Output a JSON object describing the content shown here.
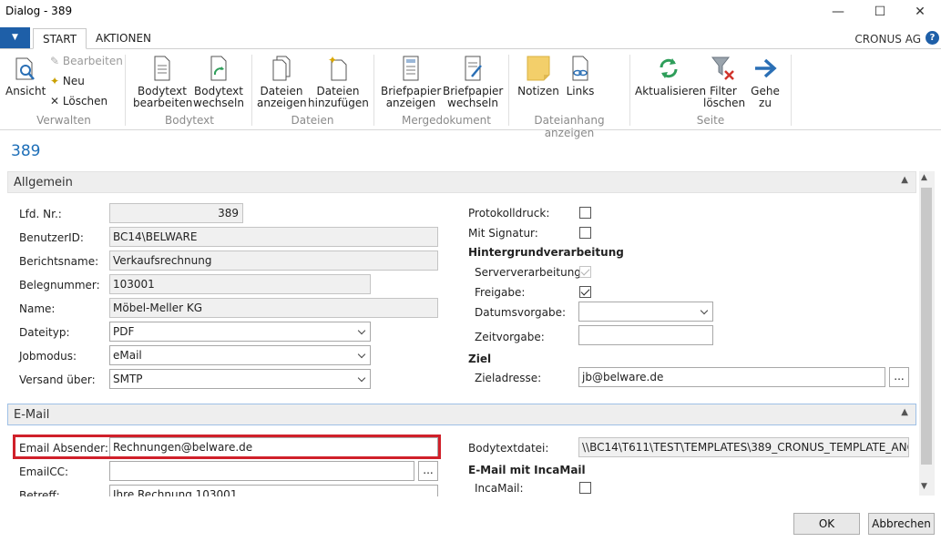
{
  "window": {
    "title": "Dialog - 389",
    "minimize": "—",
    "maximize": "☐",
    "close": "✕"
  },
  "ribbon_tabs": {
    "menu": "▼",
    "start": "START",
    "actions": "AKTIONEN"
  },
  "company": "CRONUS AG",
  "help": "?",
  "ribbon": {
    "ansicht": "Ansicht",
    "bearbeiten": "Bearbeiten",
    "neu": "Neu",
    "loeschen": "Löschen",
    "verwalten": "Verwalten",
    "bodytext_bearbeiten": [
      "Bodytext",
      "bearbeiten"
    ],
    "bodytext_wechseln": [
      "Bodytext",
      "wechseln"
    ],
    "bodytext_group": "Bodytext",
    "dateien_anzeigen": [
      "Dateien",
      "anzeigen"
    ],
    "dateien_hinzufuegen": [
      "Dateien",
      "hinzufügen"
    ],
    "dateien_group": "Dateien",
    "briefpapier_anzeigen": [
      "Briefpapier",
      "anzeigen"
    ],
    "briefpapier_wechseln": [
      "Briefpapier",
      "wechseln"
    ],
    "mergedokument_group": "Mergedokument",
    "notizen": "Notizen",
    "links": "Links",
    "dateianhang_group": "Dateianhang anzeigen",
    "aktualisieren": "Aktualisieren",
    "filter_loeschen": [
      "Filter",
      "löschen"
    ],
    "gehe_zu": [
      "Gehe",
      "zu"
    ],
    "seite_group": "Seite"
  },
  "page_title": "389",
  "allgemein": {
    "header": "Allgemein",
    "lfd_nr_label": "Lfd. Nr.:",
    "lfd_nr": "389",
    "benutzer_label": "BenutzerID:",
    "benutzer": "BC14\\BELWARE",
    "bericht_label": "Berichtsname:",
    "bericht": "Verkaufsrechnung",
    "beleg_label": "Belegnummer:",
    "beleg": "103001",
    "name_label": "Name:",
    "name": "Möbel-Meller KG",
    "dateityp_label": "Dateityp:",
    "dateityp": "PDF",
    "jobmodus_label": "Jobmodus:",
    "jobmodus": "eMail",
    "versand_label": "Versand über:",
    "versand": "SMTP",
    "protokoll_label": "Protokolldruck:",
    "protokoll": false,
    "signatur_label": "Mit Signatur:",
    "signatur": false,
    "hintergrund_label": "Hintergrundverarbeitung",
    "server_label": "Serververarbeitung:",
    "server": true,
    "freigabe_label": "Freigabe:",
    "freigabe": true,
    "datum_label": "Datumsvorgabe:",
    "datum": "",
    "zeit_label": "Zeitvorgabe:",
    "zeit": "",
    "ziel_label": "Ziel",
    "zieladresse_label": "Zieladresse:",
    "zieladresse": "jb@belware.de",
    "lookup": "..."
  },
  "email": {
    "header": "E-Mail",
    "absender_label": "Email Absender:",
    "absender": "Rechnungen@belware.de",
    "cc_label": "EmailCC:",
    "cc": "",
    "betreff_label": "Betreff:",
    "betreff": "Ihre Rechnung 103001",
    "bodytextdatei_label": "Bodytextdatei:",
    "bodytextdatei": "\\\\BC14\\T611\\TEST\\TEMPLATES\\389_CRONUS_TEMPLATE_ANG....",
    "incamail_section": "E-Mail mit IncaMail",
    "incamail_label": "IncaMail:",
    "incamail": false,
    "lookup": "..."
  },
  "buttons": {
    "ok": "OK",
    "cancel": "Abbrechen"
  }
}
